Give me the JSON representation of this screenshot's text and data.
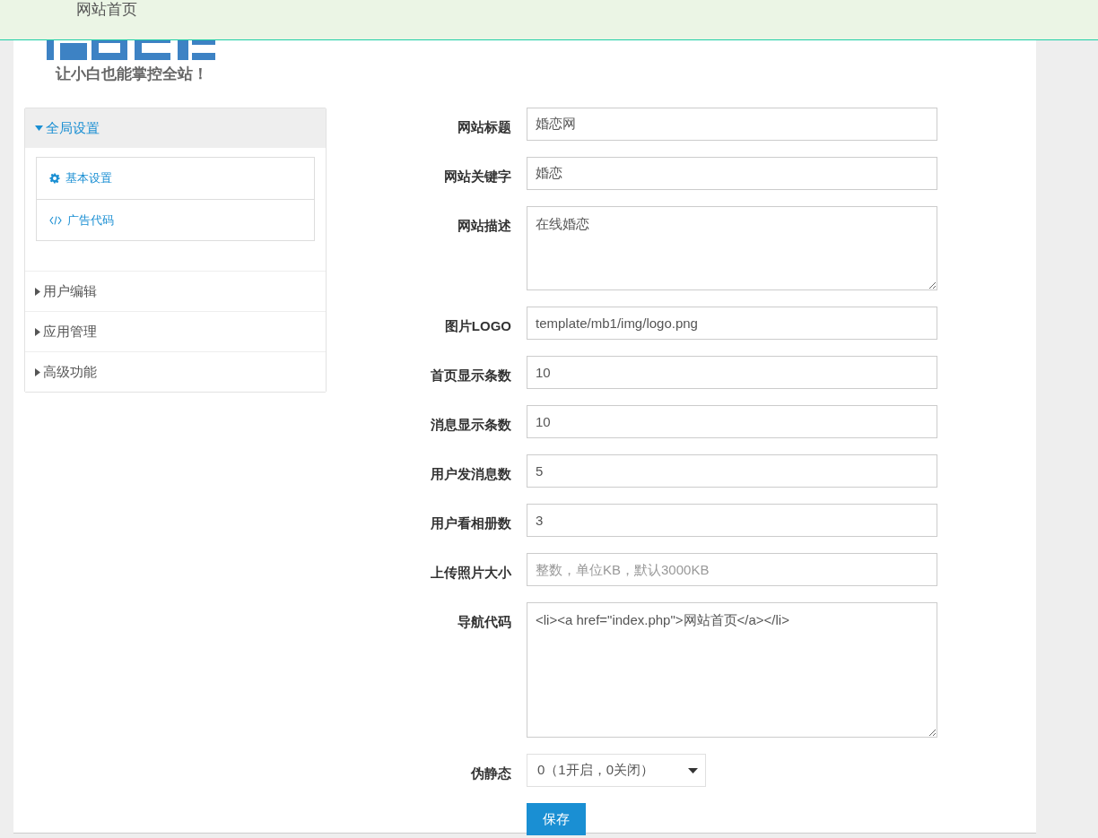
{
  "top_nav": {
    "link": "网站首页"
  },
  "logo": {
    "tagline": "让小白也能掌控全站！"
  },
  "sidebar": {
    "groups": [
      {
        "label": "全局设置",
        "expanded": true,
        "children": [
          {
            "label": "基本设置",
            "kind": "gear"
          },
          {
            "label": "广告代码",
            "kind": "code"
          }
        ]
      },
      {
        "label": "用户编辑",
        "expanded": false
      },
      {
        "label": "应用管理",
        "expanded": false
      },
      {
        "label": "高级功能",
        "expanded": false
      }
    ]
  },
  "form": {
    "fields": [
      {
        "label": "网站标题",
        "kind": "text",
        "value": "婚恋网"
      },
      {
        "label": "网站关键字",
        "kind": "text",
        "value": "婚恋"
      },
      {
        "label": "网站描述",
        "kind": "textarea",
        "value": "在线婚恋"
      },
      {
        "label": "图片LOGO",
        "kind": "text",
        "value": "template/mb1/img/logo.png"
      },
      {
        "label": "首页显示条数",
        "kind": "text",
        "value": "10"
      },
      {
        "label": "消息显示条数",
        "kind": "text",
        "value": "10"
      },
      {
        "label": "用户发消息数",
        "kind": "text",
        "value": "5"
      },
      {
        "label": "用户看相册数",
        "kind": "text",
        "value": "3"
      },
      {
        "label": "上传照片大小",
        "kind": "text",
        "placeholder": "整数，单位KB，默认3000KB"
      },
      {
        "label": "导航代码",
        "kind": "codearea",
        "value": "<li><a href=\"index.php\">网站首页</a></li>"
      },
      {
        "label": "伪静态",
        "kind": "select",
        "value": "0（1开启，0关闭）"
      }
    ],
    "submit": "保存"
  }
}
